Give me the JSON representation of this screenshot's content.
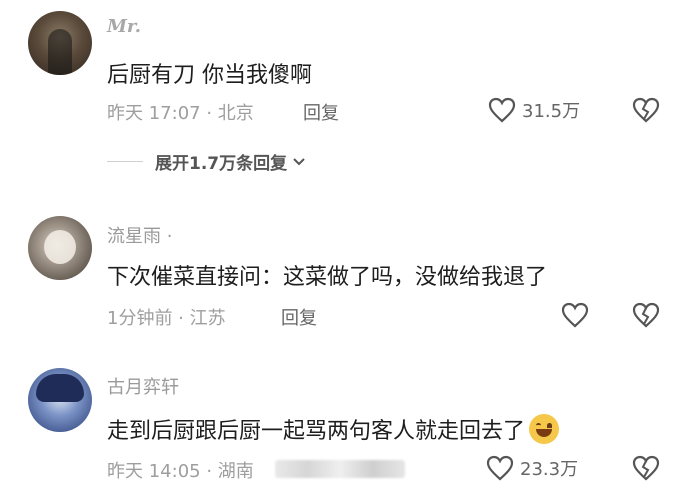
{
  "comments": [
    {
      "user": "Mr.",
      "text": "后厨有刀 你当我傻啊",
      "meta": "昨天 17:07 · 北京",
      "reply_label": "回复",
      "likes": "31.5万",
      "expand_label": "展开1.7万条回复"
    },
    {
      "user": "流星雨 ·",
      "text": "下次催菜直接问：这菜做了吗，没做给我退了",
      "meta": "1分钟前 · 江苏",
      "reply_label": "回复",
      "likes": ""
    },
    {
      "user": "古月弈轩",
      "text": "走到后厨跟后厨一起骂两句客人就走回去了",
      "meta": "昨天 14:05 · 湖南",
      "reply_label": "回复",
      "likes": "23.3万"
    }
  ],
  "icons": {
    "heart": "heart-icon",
    "broken_heart": "broken-heart-icon",
    "chevron": "chevron-down-icon",
    "emoji": "grinning-emoji-icon"
  }
}
